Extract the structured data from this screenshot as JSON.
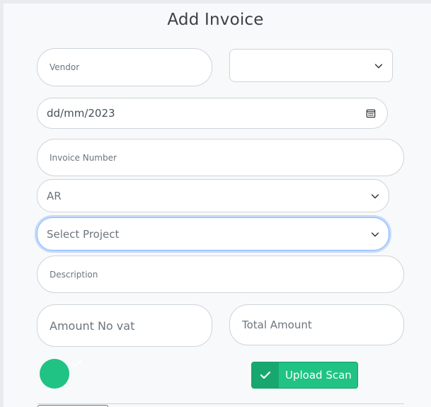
{
  "form": {
    "title": "Add Invoice",
    "vendor": {
      "placeholder": "Vendor"
    },
    "vendor_select": {
      "selected": ""
    },
    "date": {
      "value": "dd/mm/2023"
    },
    "invoice_number": {
      "placeholder": "Invoice Number"
    },
    "type_select": {
      "selected": "AR"
    },
    "project_select": {
      "selected": "Select Project"
    },
    "description": {
      "placeholder": "Description"
    },
    "amount_no_vat": {
      "placeholder": "Amount No vat"
    },
    "total_amount": {
      "placeholder": "Total Amount"
    },
    "upload_button": {
      "label": "Upload Scan"
    }
  },
  "colors": {
    "accent": "#20c384",
    "focus_ring": "#86b7fe"
  },
  "icons": {
    "chevron": "chevron-down-icon",
    "calendar": "calendar-icon",
    "check": "check-icon"
  }
}
